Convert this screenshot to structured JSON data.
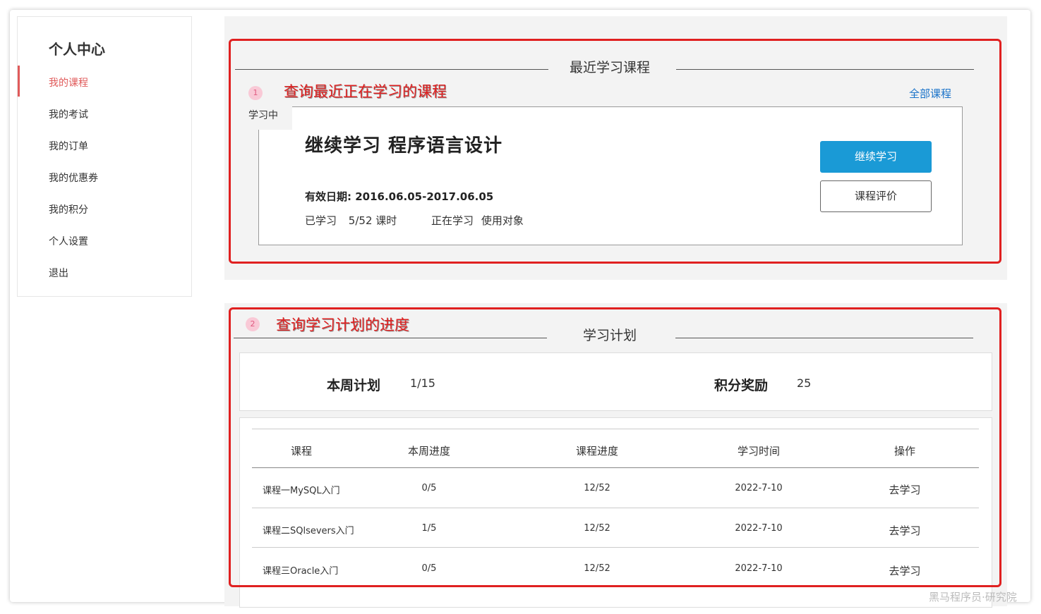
{
  "sidebar": {
    "title": "个人中心",
    "items": [
      {
        "label": "我的课程",
        "active": true
      },
      {
        "label": "我的考试",
        "active": false
      },
      {
        "label": "我的订单",
        "active": false
      },
      {
        "label": "我的优惠券",
        "active": false
      },
      {
        "label": "我的积分",
        "active": false
      },
      {
        "label": "个人设置",
        "active": false
      },
      {
        "label": "退出",
        "active": false
      }
    ],
    "active_color": "#e05a5a"
  },
  "recent": {
    "title": "最近学习课程",
    "annotation_num": "1",
    "annotation": "查询最近正在学习的课程",
    "all_courses_link": "全部课程",
    "status_tag": "学习中",
    "course_title": "继续学习  程序语言设计",
    "valid_date": "有效日期: 2016.06.05-2017.06.05",
    "learned_label": "已学习",
    "learned_value": "5/52 课时",
    "status_text": "正在学习",
    "target_text": "使用对象",
    "continue_button": "继续学习",
    "rate_button": "课程评价"
  },
  "plan": {
    "title": "学习计划",
    "annotation_num": "2",
    "annotation": "查询学习计划的进度",
    "week_plan_label": "本周计划",
    "week_plan_value": "1/15",
    "points_label": "积分奖励",
    "points_value": "25",
    "columns": [
      "课程",
      "本周进度",
      "课程进度",
      "学习时间",
      "操作"
    ],
    "rows": [
      {
        "course": "课程一MySQL入门",
        "week": "0/5",
        "progress": "12/52",
        "time": "2022-7-10",
        "action": "去学习"
      },
      {
        "course": "课程二SQlsevers入门",
        "week": "1/5",
        "progress": "12/52",
        "time": "2022-7-10",
        "action": "去学习"
      },
      {
        "course": "课程三Oracle入门",
        "week": "0/5",
        "progress": "12/52",
        "time": "2022-7-10",
        "action": "去学习"
      }
    ]
  },
  "colors": {
    "accent_blue": "#1a9ad6",
    "link_blue": "#1a73c9",
    "annotation_red": "#e02020"
  },
  "watermark": "黑马程序员·研究院"
}
